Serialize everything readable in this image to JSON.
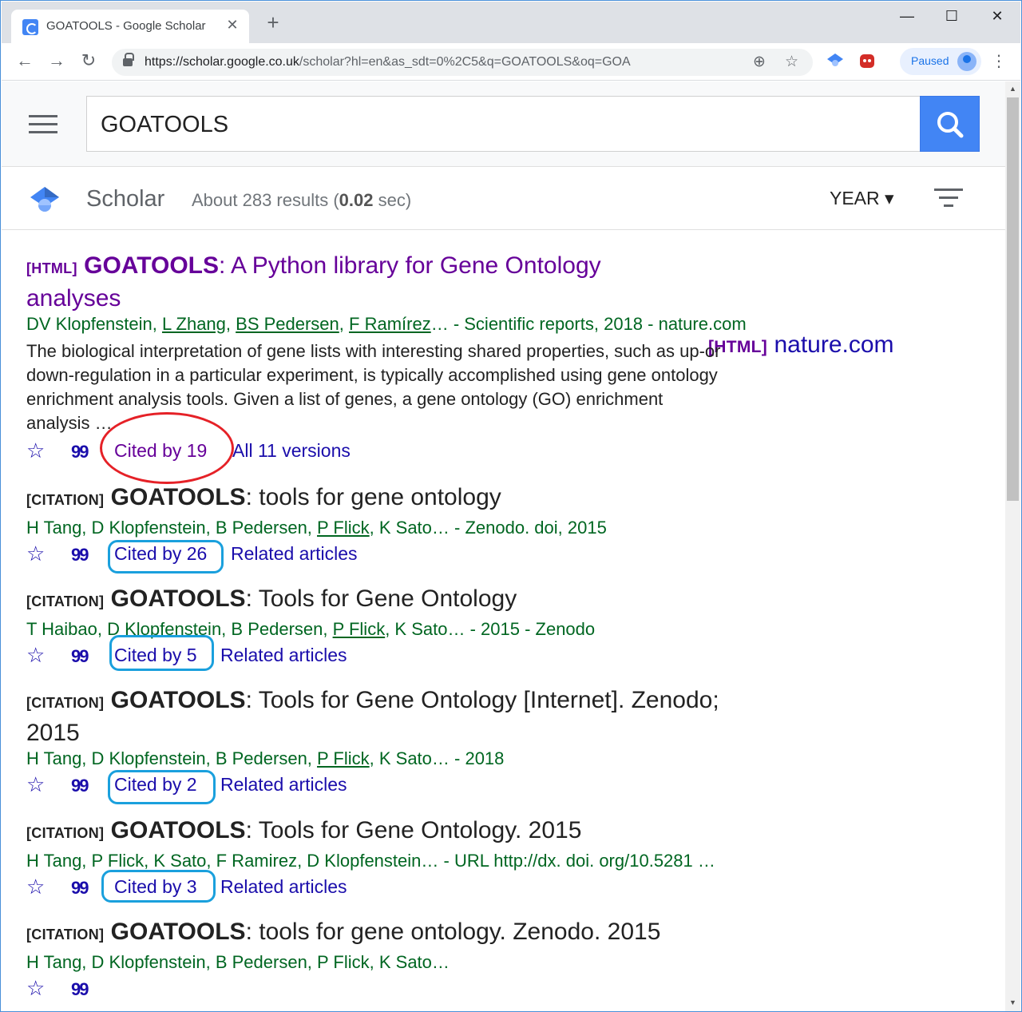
{
  "browser": {
    "tab_title": "GOATOOLS - Google Scholar",
    "tab_close": "✕",
    "new_tab": "+",
    "window_controls": {
      "minimize": "—",
      "maximize": "☐",
      "close": "✕"
    },
    "nav": {
      "back": "←",
      "forward": "→",
      "reload": "↻"
    },
    "url_host": "https://scholar.google.co.uk",
    "url_path": "/scholar?hl=en&as_sdt=0%2C5&q=GOATOOLS&oq=GOA",
    "profile_label": "Paused",
    "menu": "⋮",
    "zoom_icon": "⊕",
    "bookmark_icon": "☆"
  },
  "search": {
    "query": "GOATOOLS",
    "menu_icon": "hamburger-icon",
    "search_icon": "search-icon"
  },
  "scholar_header": {
    "title": "Scholar",
    "stats_prefix": "About 283 results (",
    "stats_time": "0.02",
    "stats_suffix": " sec)",
    "year_filter": "YEAR ▾"
  },
  "results": [
    {
      "tag": "[HTML]",
      "title_bold": "GOATOOLS",
      "title_line1": ": A Python library for Gene Ontology",
      "title_line2": "analyses",
      "authors": [
        {
          "text": "DV Klopfenstein, ",
          "link": false
        },
        {
          "text": "L Zhang",
          "link": true
        },
        {
          "text": ", ",
          "link": false
        },
        {
          "text": "BS Pedersen",
          "link": true
        },
        {
          "text": ", ",
          "link": false
        },
        {
          "text": "F Ramírez",
          "link": true
        },
        {
          "text": "… - Scientific reports, 2018 - nature.com",
          "link": false
        }
      ],
      "snippet": [
        "The biological interpretation of gene lists with interesting shared properties, such as up-or",
        "down-regulation in a particular experiment, is typically accomplished using gene ontology",
        "enrichment analysis tools. Given a list of genes, a gene ontology (GO) enrichment",
        "analysis …"
      ],
      "cited": "Cited by 19",
      "extra": "All 11 versions",
      "side_tag": "[HTML]",
      "side_link": "nature.com"
    },
    {
      "tag": "[CITATION]",
      "title_bold": "GOATOOLS",
      "title_line1": ": tools for gene ontology",
      "authors": [
        {
          "text": "H Tang, D Klopfenstein, B Pedersen, ",
          "link": false
        },
        {
          "text": "P Flick",
          "link": true
        },
        {
          "text": ", K Sato… - Zenodo. doi, 2015",
          "link": false
        }
      ],
      "cited": "Cited by 26",
      "extra": "Related articles"
    },
    {
      "tag": "[CITATION]",
      "title_bold": "GOATOOLS",
      "title_line1": ": Tools for Gene Ontology",
      "authors": [
        {
          "text": "T Haibao, D Klopfenstein, B Pedersen, ",
          "link": false
        },
        {
          "text": "P Flick",
          "link": true
        },
        {
          "text": ", K Sato… - 2015 - Zenodo",
          "link": false
        }
      ],
      "cited": "Cited by 5",
      "extra": "Related articles"
    },
    {
      "tag": "[CITATION]",
      "title_bold": "GOATOOLS",
      "title_line1": ": Tools for Gene Ontology [Internet]. Zenodo;",
      "title_line2": "2015",
      "authors": [
        {
          "text": "H Tang, D Klopfenstein, B Pedersen, ",
          "link": false
        },
        {
          "text": "P Flick",
          "link": true
        },
        {
          "text": ", K Sato… - 2018",
          "link": false
        }
      ],
      "cited": "Cited by 2",
      "extra": "Related articles"
    },
    {
      "tag": "[CITATION]",
      "title_bold": "GOATOOLS",
      "title_line1": ": Tools for Gene Ontology. 2015",
      "authors": [
        {
          "text": "H Tang, P Flick, K Sato, F Ramirez, D Klopfenstein… - URL http://dx. doi. org/10.5281 …",
          "link": false
        }
      ],
      "cited": "Cited by 3",
      "extra": "Related articles"
    },
    {
      "tag": "[CITATION]",
      "title_bold": "GOATOOLS",
      "title_line1": ": tools for gene ontology. Zenodo. 2015",
      "authors": [
        {
          "text": "H Tang, D Klopfenstein, B Pedersen, P Flick, K Sato…",
          "link": false
        }
      ]
    }
  ],
  "icons": {
    "star": "☆",
    "quote": "99"
  },
  "colors": {
    "link": "#1a0dab",
    "visited": "#660099",
    "authors": "#006621",
    "search_button": "#4285f4",
    "highlight_red": "#e52127",
    "highlight_blue": "#1aa0dd"
  }
}
